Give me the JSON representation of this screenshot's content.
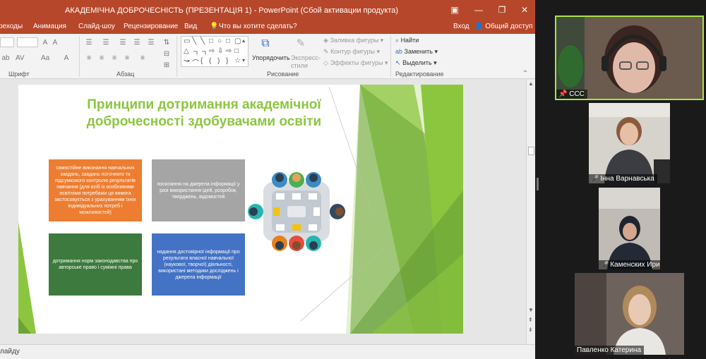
{
  "window": {
    "title": "АКАДЕМІЧНА ДОБРОЧЕСНІСТЬ (ПРЕЗЕНТАЦІЯ 1) - PowerPoint (Сбой активации продукта)",
    "restore_icon": "ribbon-display-icon",
    "maximize_icon": "restore-icon",
    "close_icon": "close-icon"
  },
  "menu": {
    "tabs": [
      "реходы",
      "Анимация",
      "Слайд-шоу",
      "Рецензирование",
      "Вид"
    ],
    "tell_me": "Что вы хотите сделать?",
    "signin": "Вход",
    "share": "Общий доступ"
  },
  "ribbon": {
    "groups": {
      "font": "Шрифт",
      "paragraph": "Абзац",
      "drawing": "Рисование",
      "editing": "Редактирование"
    },
    "arrange": "Упорядочить",
    "quick_styles": "Экспресс-\nстили",
    "shape_fill": "Заливка фигуры",
    "shape_outline": "Контур фигуры",
    "shape_effects": "Эффекты фигуры",
    "find": "Найти",
    "replace": "Заменить",
    "select": "Выделить"
  },
  "slide": {
    "title": "Принципи дотримання академічної доброчесності здобувачами освіти",
    "boxes": [
      "самостійне виконання навчальних завдань, завдань поточного та підсумкового контролю результатів навчання (для осіб із особливими освітніми потребами ця вимога застосовується з урахуванням їхніх індивідуальних потреб і можливостей)",
      "посилання на джерела інформації у разі використання ідей, розробок, тверджень, відомостей",
      "дотримання норм законодавства про авторське право і суміжні права",
      "надання достовірної інформації про результати власної навчальної (наукової, творчої) діяльності, використані методики досліджень і джерела інформації"
    ]
  },
  "status": {
    "text": "лайду"
  },
  "participants": [
    {
      "name": "ССС",
      "muted": false
    },
    {
      "name": "Інна Варнавська",
      "muted": true
    },
    {
      "name": "Каменских Ирина",
      "muted": true
    },
    {
      "name": "Павленко Катерина",
      "muted": false
    }
  ]
}
